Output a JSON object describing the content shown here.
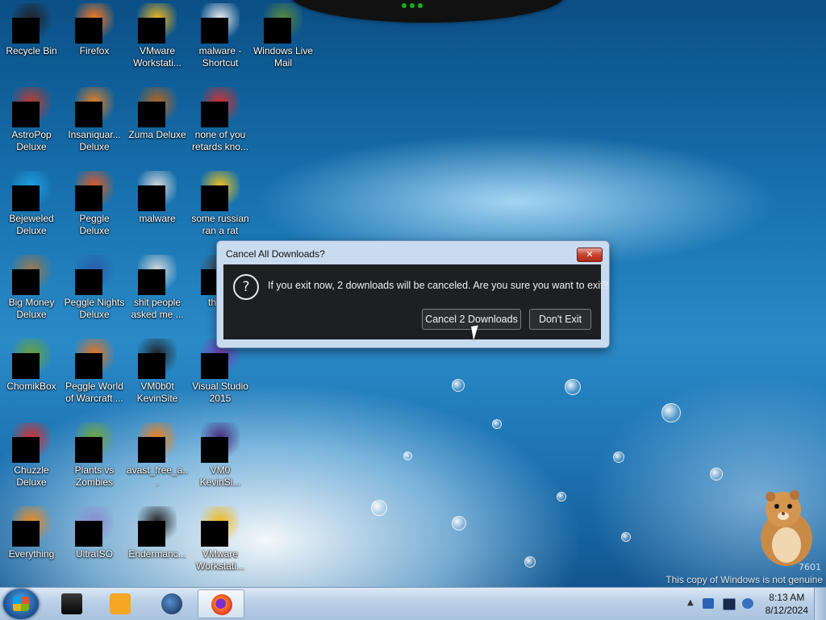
{
  "desktop": {
    "icons": [
      {
        "label": "Recycle Bin",
        "icon": "recycle-bin-icon"
      },
      {
        "label": "Firefox",
        "icon": "firefox-icon"
      },
      {
        "label": "VMware Workstati...",
        "icon": "vmware-icon"
      },
      {
        "label": "malware - Shortcut",
        "icon": "folder-shortcut-icon"
      },
      {
        "label": "Windows Live Mail",
        "icon": "windows-live-mail-icon"
      },
      {
        "label": "AstroPop Deluxe",
        "icon": "astropop-icon"
      },
      {
        "label": "Insaniquar... Deluxe",
        "icon": "insaniquarium-icon"
      },
      {
        "label": "Zuma Deluxe",
        "icon": "zuma-icon"
      },
      {
        "label": "none of you retards kno...",
        "icon": "red-disc-icon"
      },
      {
        "label": "Bejeweled Deluxe",
        "icon": "bejeweled-icon"
      },
      {
        "label": "Peggle Deluxe",
        "icon": "peggle-icon"
      },
      {
        "label": "malware",
        "icon": "folder-icon"
      },
      {
        "label": "some russian ran a rat",
        "icon": "document-icon"
      },
      {
        "label": "Big Money Deluxe",
        "icon": "big-money-icon"
      },
      {
        "label": "Peggle Nights Deluxe",
        "icon": "peggle-nights-icon"
      },
      {
        "label": "shit people asked me ...",
        "icon": "folder-icon"
      },
      {
        "label": "that b",
        "icon": "file-icon"
      },
      {
        "label": "ChomikBox",
        "icon": "chomikbox-icon"
      },
      {
        "label": "Peggle World of Warcraft ...",
        "icon": "peggle-wow-icon"
      },
      {
        "label": "VM0b0t KevinSite",
        "icon": "monitor-icon"
      },
      {
        "label": "Visual Studio 2015",
        "icon": "visual-studio-icon"
      },
      {
        "label": "Chuzzle Deluxe",
        "icon": "chuzzle-icon"
      },
      {
        "label": "Plants vs Zombies",
        "icon": "pvz-icon"
      },
      {
        "label": "avast_free_a...",
        "icon": "avast-icon"
      },
      {
        "label": "VM0 KevinSi...",
        "icon": "vm-icon"
      },
      {
        "label": "Everything",
        "icon": "everything-icon"
      },
      {
        "label": "UltraISO",
        "icon": "ultraiso-icon"
      },
      {
        "label": "Endermanc...",
        "icon": "terminal-icon"
      },
      {
        "label": "VMware Workstati...",
        "icon": "vmware-icon"
      }
    ],
    "watermark": {
      "build": "7601",
      "text": "This copy of Windows is not genuine"
    }
  },
  "dialog": {
    "title": "Cancel All Downloads?",
    "close_label": "✕",
    "message": "If you exit now, 2 downloads will be canceled. Are you sure you want to exit?",
    "primary_button": "Cancel 2 Downloads",
    "secondary_button": "Don't Exit"
  },
  "taskbar": {
    "items": [
      {
        "icon": "start-orb-icon"
      },
      {
        "icon": "black-box-app-icon"
      },
      {
        "icon": "media-player-icon"
      },
      {
        "icon": "globe-app-icon"
      },
      {
        "icon": "firefox-icon",
        "active": true
      }
    ],
    "clock": {
      "time": "8:13 AM",
      "date": "8/12/2024"
    }
  },
  "colors": {
    "accent": "#1d6fb1",
    "dialog_bg": "#1e1f23",
    "close": "#c8432f"
  }
}
